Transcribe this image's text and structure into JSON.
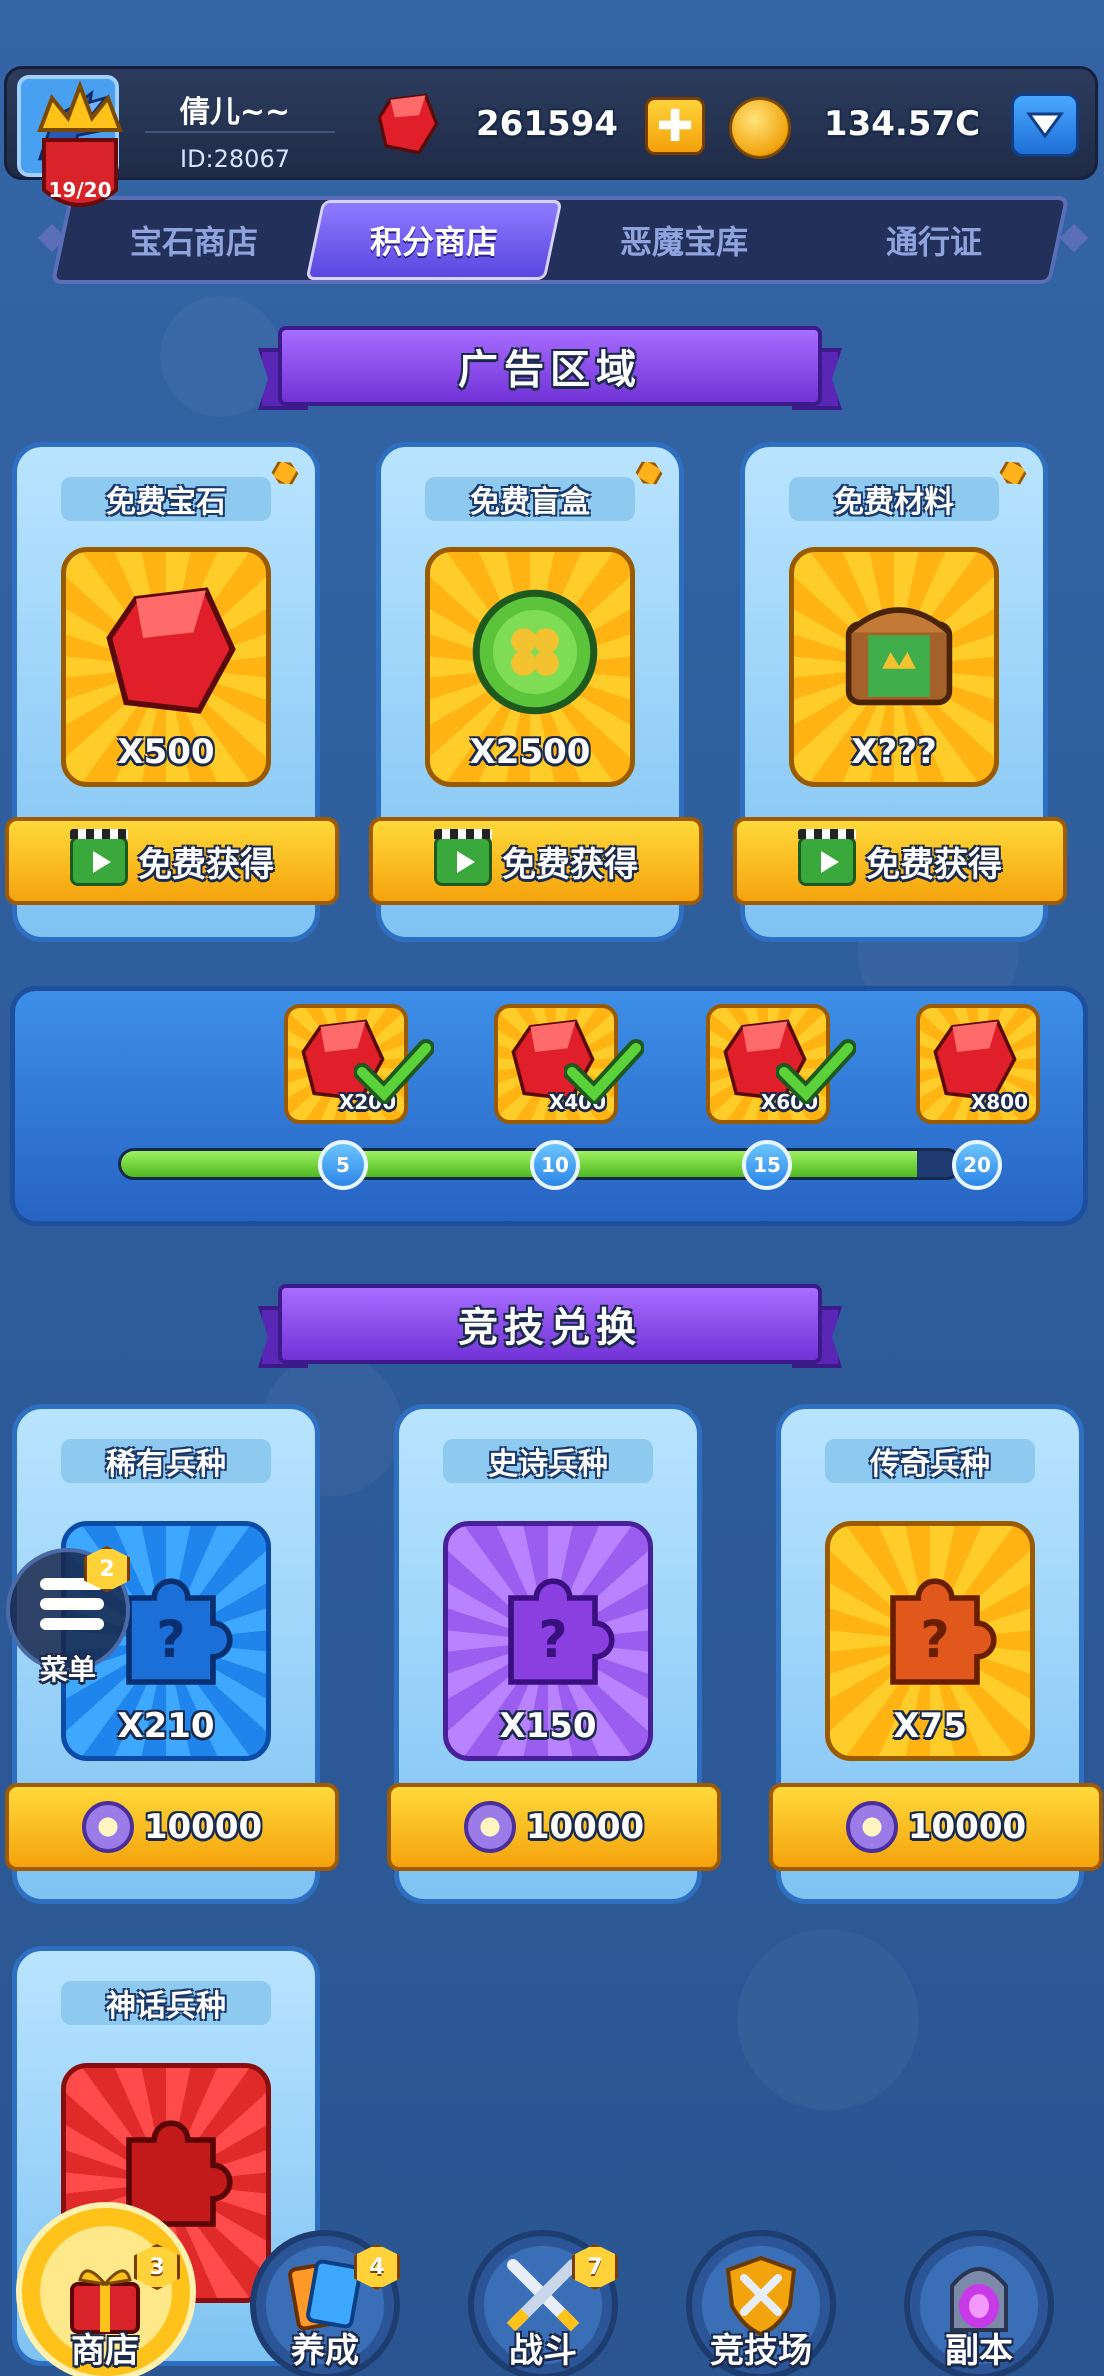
{
  "player": {
    "name": "倩儿~~",
    "id_label": "ID:28067",
    "gems": "261594",
    "coins": "134.57C"
  },
  "tabs": [
    {
      "label": "宝石商店",
      "active": false
    },
    {
      "label": "积分商店",
      "active": true
    },
    {
      "label": "恶魔宝库",
      "active": false
    },
    {
      "label": "通行证",
      "active": false
    }
  ],
  "ad_section": {
    "title": "广告区域",
    "cards": [
      {
        "title": "免费宝石",
        "qty": "X500",
        "button": "免费获得",
        "icon": "red-gem-icon"
      },
      {
        "title": "免费盲盒",
        "qty": "X2500",
        "button": "免费获得",
        "icon": "clover-coin-icon"
      },
      {
        "title": "免费材料",
        "qty": "X???",
        "button": "免费获得",
        "icon": "treasure-chest-icon"
      }
    ]
  },
  "progress": {
    "current": 19,
    "total": 20,
    "label": "19/20",
    "milestones": [
      "5",
      "10",
      "15",
      "20"
    ],
    "rewards": [
      {
        "qty": "X200",
        "claimed": true
      },
      {
        "qty": "X400",
        "claimed": true
      },
      {
        "qty": "X600",
        "claimed": true
      },
      {
        "qty": "X800",
        "claimed": false
      }
    ]
  },
  "exchange_section": {
    "title": "竞技兑换",
    "cards": [
      {
        "title": "稀有兵种",
        "qty": "X210",
        "price": "10000",
        "color": "blue"
      },
      {
        "title": "史诗兵种",
        "qty": "X150",
        "price": "10000",
        "color": "purple"
      },
      {
        "title": "传奇兵种",
        "qty": "X75",
        "price": "10000",
        "color": "gold"
      },
      {
        "title": "神话兵种",
        "qty": "",
        "price": "",
        "color": "red"
      }
    ]
  },
  "float_menu": {
    "label": "菜单",
    "badge": "2"
  },
  "bottom_nav": [
    {
      "label": "商店",
      "badge": "3",
      "active": true
    },
    {
      "label": "养成",
      "badge": "4",
      "active": false
    },
    {
      "label": "战斗",
      "badge": "7",
      "active": false
    },
    {
      "label": "竞技场",
      "badge": "",
      "active": false
    },
    {
      "label": "副本",
      "badge": "",
      "active": false
    }
  ],
  "colors": {
    "background": "#2f5f9e",
    "gem_red": "#e01f2a",
    "accent_gold": "#ffc21a",
    "tab_active": "#6f5cf0",
    "progress_green": "#6ad23a"
  }
}
